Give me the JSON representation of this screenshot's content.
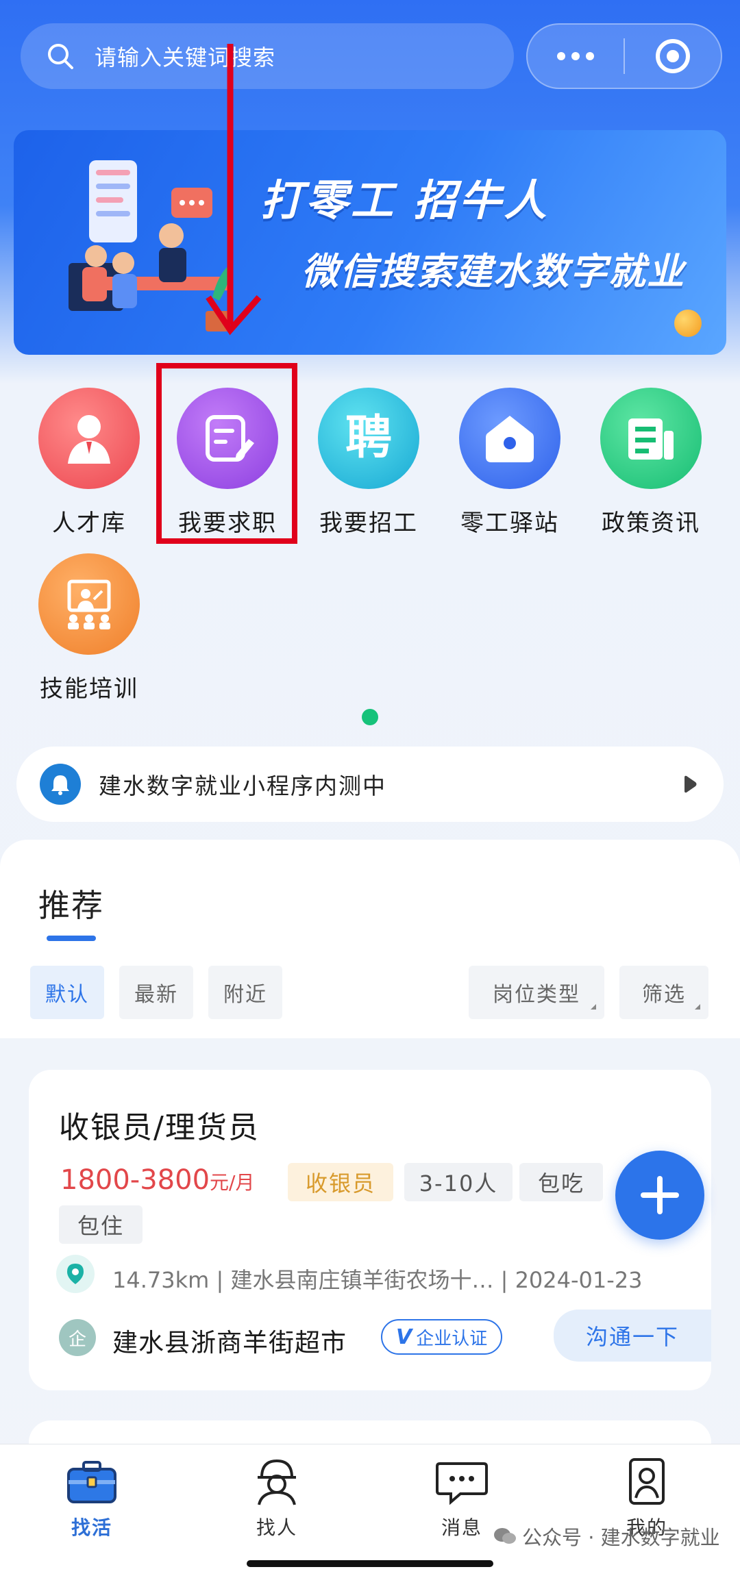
{
  "search": {
    "placeholder": "请输入关键词搜索"
  },
  "banner": {
    "line1": "打零工 招牛人",
    "line2": "微信搜索建水数字就业"
  },
  "grid": {
    "items": [
      {
        "label": "人才库",
        "icon": "talent-pool-icon",
        "color": "#f0545a"
      },
      {
        "label": "我要求职",
        "icon": "resume-edit-icon",
        "color": "#9b46e6"
      },
      {
        "label": "我要招工",
        "icon": "recruit-icon",
        "color": "#1fb8d9"
      },
      {
        "label": "零工驿站",
        "icon": "gig-station-icon",
        "color": "#3b6ff0"
      },
      {
        "label": "政策资讯",
        "icon": "policy-news-icon",
        "color": "#1fc47d"
      },
      {
        "label": "技能培训",
        "icon": "skill-training-icon",
        "color": "#f28a2e"
      }
    ]
  },
  "notice": {
    "text": "建水数字就业小程序内测中"
  },
  "recommend": {
    "title": "推荐",
    "sorts": [
      "默认",
      "最新",
      "附近"
    ],
    "filters": [
      "岗位类型",
      "筛选"
    ]
  },
  "job": {
    "title": "收银员/理货员",
    "salary": "1800-3800",
    "salary_unit": "元/月",
    "tags": [
      "收银员",
      "3-10人",
      "包吃",
      "包住"
    ],
    "location": "14.73km | 建水县南庄镇羊街农场十… | 2024-01-23",
    "company": "建水县浙商羊街超市",
    "company_avatar": "企",
    "cert": "企业认证",
    "contact": "沟通一下"
  },
  "bottom_nav": [
    {
      "label": "找活",
      "active": true
    },
    {
      "label": "找人",
      "active": false
    },
    {
      "label": "消息",
      "active": false
    },
    {
      "label": "我的",
      "active": false
    }
  ],
  "watermark": "公众号 · 建水数字就业",
  "colors": {
    "primary": "#2d74e8",
    "salary": "#e2474a",
    "highlight_box": "#e0001b"
  }
}
